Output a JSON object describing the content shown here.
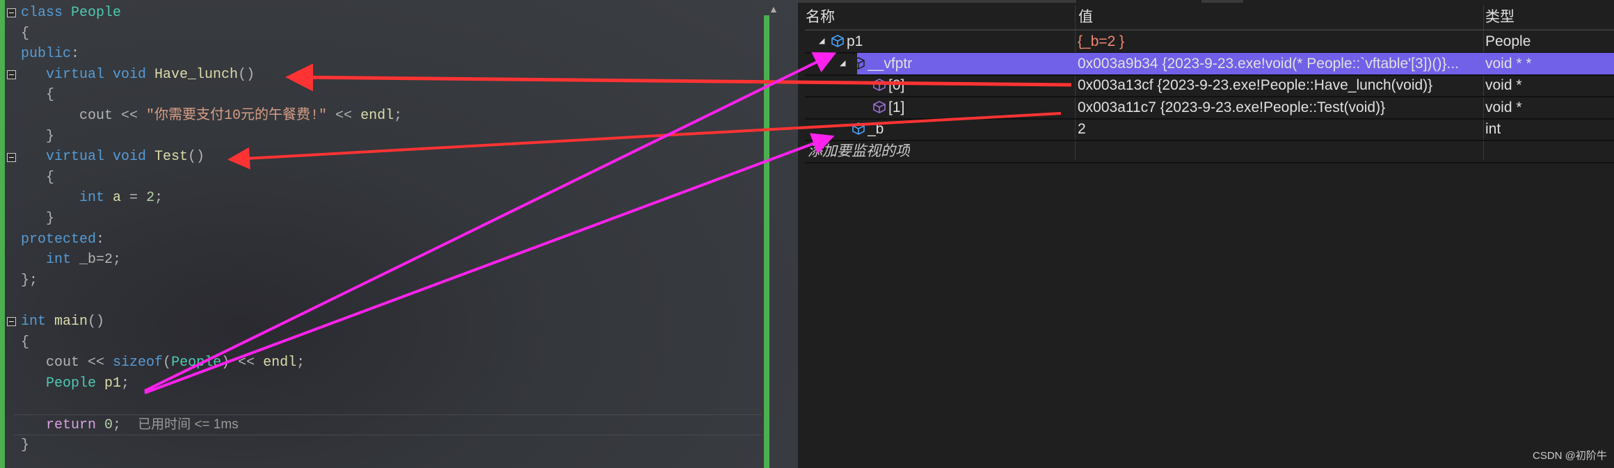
{
  "editor": {
    "lines": [
      [
        {
          "t": "class ",
          "c": "kw"
        },
        {
          "t": "People",
          "c": "ty"
        }
      ],
      [
        {
          "t": "{",
          "c": "op"
        }
      ],
      [
        {
          "t": "public",
          "c": "kw"
        },
        {
          "t": ":",
          "c": "op"
        }
      ],
      [
        {
          "t": "   virtual void ",
          "c": "kw"
        },
        {
          "t": "Have_lunch",
          "c": "fn"
        },
        {
          "t": "()",
          "c": "op"
        }
      ],
      [
        {
          "t": "   {",
          "c": "op"
        }
      ],
      [
        {
          "t": "       cout << ",
          "c": "op"
        },
        {
          "t": "\"你需要支付10元的午餐费!\"",
          "c": "st"
        },
        {
          "t": " << ",
          "c": "op"
        },
        {
          "t": "endl",
          "c": "fn"
        },
        {
          "t": ";",
          "c": "op"
        }
      ],
      [
        {
          "t": "   }",
          "c": "op"
        }
      ],
      [
        {
          "t": "   virtual void ",
          "c": "kw"
        },
        {
          "t": "Test",
          "c": "fn"
        },
        {
          "t": "()",
          "c": "op"
        }
      ],
      [
        {
          "t": "   {",
          "c": "op"
        }
      ],
      [
        {
          "t": "       int ",
          "c": "kw"
        },
        {
          "t": "a",
          "c": "fn"
        },
        {
          "t": " = ",
          "c": "op"
        },
        {
          "t": "2",
          "c": "nu"
        },
        {
          "t": ";",
          "c": "op"
        }
      ],
      [
        {
          "t": "   }",
          "c": "op"
        }
      ],
      [
        {
          "t": "protected",
          "c": "kw"
        },
        {
          "t": ":",
          "c": "op"
        }
      ],
      [
        {
          "t": "   int ",
          "c": "kw"
        },
        {
          "t": "_b=2;",
          "c": "op"
        }
      ],
      [
        {
          "t": "};",
          "c": "op"
        }
      ],
      [],
      [
        {
          "t": "int ",
          "c": "kw"
        },
        {
          "t": "main",
          "c": "fn"
        },
        {
          "t": "()",
          "c": "op"
        }
      ],
      [
        {
          "t": "{",
          "c": "op"
        }
      ],
      [
        {
          "t": "   cout << ",
          "c": "op"
        },
        {
          "t": "sizeof",
          "c": "kw"
        },
        {
          "t": "(",
          "c": "op"
        },
        {
          "t": "People",
          "c": "ty"
        },
        {
          "t": ") << ",
          "c": "op"
        },
        {
          "t": "endl",
          "c": "fn"
        },
        {
          "t": ";",
          "c": "op"
        }
      ],
      [
        {
          "t": "   People ",
          "c": "ty"
        },
        {
          "t": "p1",
          "c": "fn"
        },
        {
          "t": ";",
          "c": "op"
        }
      ],
      [],
      [
        {
          "t": "   return ",
          "c": "rt"
        },
        {
          "t": "0",
          "c": "nu"
        },
        {
          "t": ";  ",
          "c": "op"
        },
        {
          "t": "已用时间 <= 1ms",
          "c": "hint"
        }
      ],
      [
        {
          "t": "}",
          "c": "op"
        }
      ]
    ]
  },
  "watch": {
    "headers": {
      "name": "名称",
      "value": "值",
      "type": "类型"
    },
    "rows": [
      {
        "name": "p1",
        "value": "{_b=2 }",
        "type": "People",
        "icon": "class-object-icon",
        "level": 0,
        "expanded": true
      },
      {
        "name": "__vfptr",
        "value": "0x003a9b34 {2023-9-23.exe!void(* People::`vftable'[3])()}...",
        "type": "void * *",
        "icon": "pointer-object-icon",
        "level": 1,
        "expanded": true,
        "selected": true
      },
      {
        "name": "[0]",
        "value": "0x003a13cf {2023-9-23.exe!People::Have_lunch(void)}",
        "type": "void *",
        "icon": "member-icon",
        "level": 2
      },
      {
        "name": "[1]",
        "value": "0x003a11c7 {2023-9-23.exe!People::Test(void)}",
        "type": "void *",
        "icon": "member-icon",
        "level": 2
      },
      {
        "name": "_b",
        "value": "2",
        "type": "int",
        "icon": "protected-field-icon",
        "level": 1
      }
    ],
    "add_item_placeholder": "添加要监视的项"
  },
  "colors": {
    "selection": "#7160e8",
    "arrow_red": "#ff3333",
    "arrow_magenta": "#ff22ee",
    "value_highlight": "#f48771"
  },
  "watermark": "CSDN @初阶牛"
}
